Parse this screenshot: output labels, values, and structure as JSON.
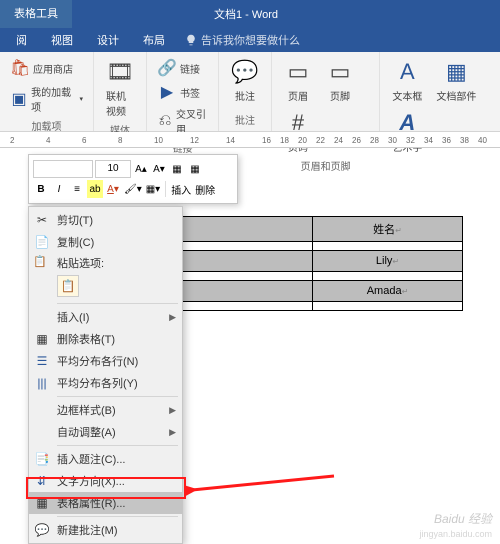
{
  "titlebar": {
    "tools_tab": "表格工具",
    "doc_title": "文档1 - Word"
  },
  "tabs": {
    "t1": "阅",
    "t2": "视图",
    "t3": "设计",
    "t4": "布局",
    "tell_me": "告诉我你想要做什么"
  },
  "ribbon": {
    "addins": {
      "store": "应用商店",
      "myaddins": "我的加载项",
      "label": "加载项"
    },
    "media": {
      "video": "联机视频",
      "label": "媒体"
    },
    "links": {
      "link": "链接",
      "bookmark": "书签",
      "crossref": "交叉引用",
      "label": "链接"
    },
    "comments": {
      "comment": "批注",
      "label": "批注"
    },
    "headerfooter": {
      "header": "页眉",
      "footer": "页脚",
      "pagenum": "页码",
      "label": "页眉和页脚"
    },
    "text": {
      "textbox": "文本框",
      "parts": "文档部件",
      "wordart": "艺术字"
    }
  },
  "ruler": [
    "2",
    "",
    "4",
    "",
    "6",
    "",
    "8",
    "",
    "10",
    "",
    "12",
    "",
    "14",
    "",
    "16",
    "18",
    "20",
    "22",
    "24",
    "26",
    "28",
    "30",
    "32",
    "34",
    "36",
    "38",
    "40"
  ],
  "mini": {
    "size": "10",
    "insert": "插入",
    "delete": "删除"
  },
  "table": {
    "h_name": "姓名",
    "r1": "Lily",
    "r2": "Amada",
    "mark": "↵"
  },
  "menu": {
    "cut": "剪切(T)",
    "copy": "复制(C)",
    "paste_label": "粘贴选项:",
    "insert": "插入(I)",
    "delete_table": "删除表格(T)",
    "dist_rows": "平均分布各行(N)",
    "dist_cols": "平均分布各列(Y)",
    "border_style": "边框样式(B)",
    "autofit": "自动调整(A)",
    "insert_caption": "插入题注(C)...",
    "text_direction": "文字方向(X)...",
    "table_props": "表格属性(R)...",
    "new_comment": "新建批注(M)"
  },
  "watermark": {
    "main": "Baidu 经验",
    "sub": "jingyan.baidu.com"
  }
}
